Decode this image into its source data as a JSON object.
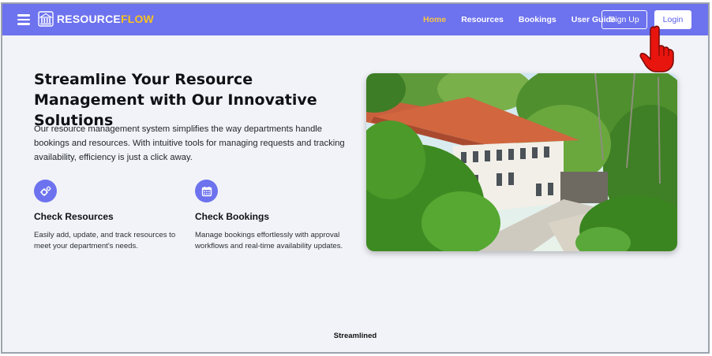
{
  "navbar": {
    "brand_part1": "RESOURCE",
    "brand_part2": "FLOW",
    "links": [
      {
        "label": "Home",
        "active": true
      },
      {
        "label": "Resources",
        "active": false
      },
      {
        "label": "Bookings",
        "active": false
      },
      {
        "label": "User Guide",
        "active": false
      }
    ],
    "signup_label": "Sign Up",
    "login_label": "Login"
  },
  "hero": {
    "title": "Streamline Your Resource Management with Our Innovative Solutions",
    "description": "Our resource management system simplifies the way departments handle bookings and resources. With intuitive tools for managing requests and tracking availability, efficiency is just a click away."
  },
  "features": [
    {
      "icon": "gears-icon",
      "title": "Check Resources",
      "description": "Easily add, update, and track resources to meet your department's needs."
    },
    {
      "icon": "calendar-icon",
      "title": "Check Bookings",
      "description": "Manage bookings effortlessly with approval workflows and real-time availability updates."
    }
  ],
  "footer": {
    "text": "Streamlined"
  },
  "colors": {
    "accent": "#6d72ee",
    "brand_yellow": "#f7c21f",
    "active_link": "#f6c34a",
    "background": "#f1f3f8"
  }
}
